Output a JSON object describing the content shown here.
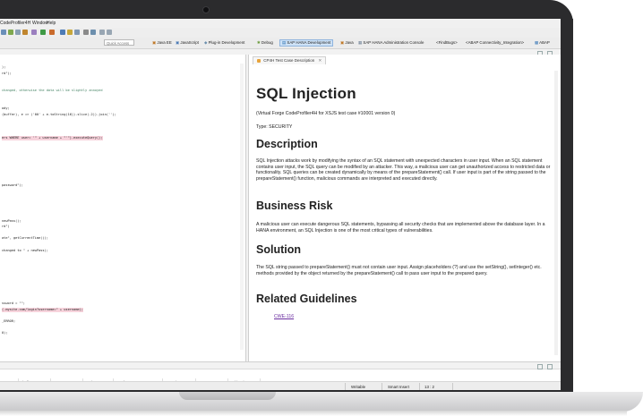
{
  "menubar": {
    "title": "CodeProfiler4H",
    "items": [
      "Window",
      "Help"
    ]
  },
  "toolbar": {
    "quick_access": "Quick Access",
    "perspectives": [
      {
        "label": "Java EE",
        "icon": "java-ee-icon"
      },
      {
        "label": "JavaScript",
        "icon": "javascript-icon"
      },
      {
        "label": "Plug-in Development",
        "icon": "plugin-icon"
      },
      {
        "label": "Debug",
        "icon": "bug-icon"
      },
      {
        "label": "SAP HANA Development",
        "icon": "hana-icon",
        "active": true
      },
      {
        "label": "Java",
        "icon": "java-icon"
      },
      {
        "label": "SAP HANA Administration Console",
        "icon": "admin-console-icon"
      },
      {
        "label": "<FindBugs>",
        "icon": "findbugs-icon"
      },
      {
        "label": "<ABAP Connectivity_Integration>",
        "icon": "abap-conn-icon"
      },
      {
        "label": "ABAP",
        "icon": "abap-icon"
      }
    ]
  },
  "editor": {
    "code_lines": [
      ");",
      "rd\");",
      "",
      "",
      "changed, otherwise the data will be slightly annoyed",
      "",
      "",
      "ody;",
      "(buffer), e => ('00' + e.toString(16)).slice(-2)).join('');",
      "",
      "",
      "",
      "ers WHERE user= '\" + username + \"'\").executeQuery();",
      "",
      "",
      "",
      "",
      "",
      "",
      "",
      "password\");",
      "",
      "",
      "",
      "",
      "",
      "newPass();",
      "rd\")",
      "",
      "ate\", getCurrentTime());",
      "",
      "changed to \" + newPass);",
      "",
      "",
      "",
      "",
      "",
      "",
      "",
      "",
      "ssword = \"\";",
      "(.mysite.com/login?username=\" + username);",
      "",
      "_ERROR;",
      "",
      "0);"
    ],
    "highlighted": [
      12,
      25,
      41
    ]
  },
  "description": {
    "tab_label": "CP4H Test Case Description",
    "title": "SQL Injection",
    "subtitle": "(Virtual Forge CodeProfiler4H for XSJS test case #10001 version 0)",
    "type": "Type: SECURITY",
    "sections": [
      {
        "heading": "Description",
        "body": "SQL Injection attacks work by modifying the syntax of an SQL statement with unexpected characters in user input. When an SQL statement contains user input, the SQL query can be modified by an attacker. This way, a malicious user can get unauthorized access to restricted data or functionality. SQL queries can be created dynamically by means of the prepareStatement() call. If user input is part of the string passed to the prepareStatement() function, malicious commands are interpreted and executed directly."
      },
      {
        "heading": "Business Risk",
        "body": "A malicious user can execute dangerous SQL statements, bypassing all security checks that are implemented above the database layer. In a HANA environment, an SQL Injection is one of the most critical types of vulnerabilities."
      },
      {
        "heading": "Solution",
        "body": "The SQL string passed to prepareStatement() must not contain user input. Assign placeholders (?) and use the setString(), setInteger() etc. methods provided by the object returned by the prepareStatement() call to pass user input to the prepared query."
      },
      {
        "heading": "Related Guidelines",
        "link": "CWE-116"
      }
    ]
  },
  "findings": {
    "columns": [
      "ase ID",
      "Finding Type",
      "Impact",
      "Script",
      "Package",
      "Location",
      "System ID",
      "Mitigation"
    ]
  },
  "status_bar": {
    "writable": "Writable",
    "insert_mode": "Smart Insert",
    "position": "13 : 2"
  }
}
